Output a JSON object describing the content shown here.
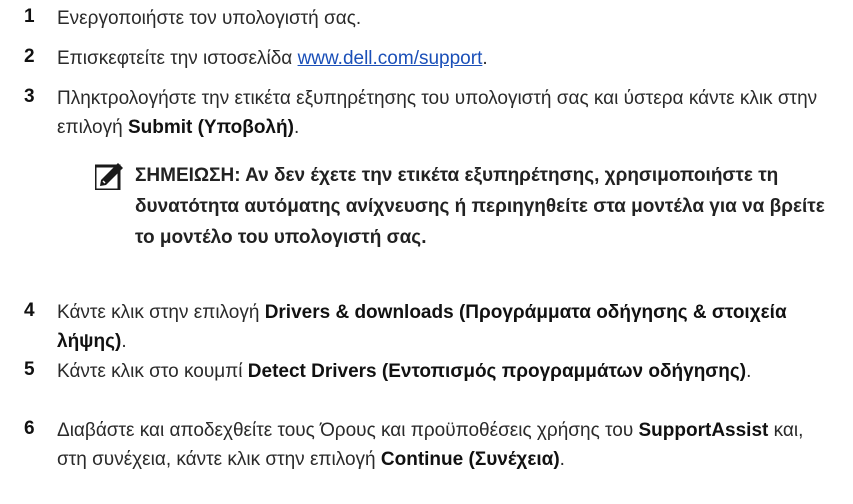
{
  "steps": [
    {
      "num": "1",
      "text": "Ενεργοποιήστε τον υπολογιστή σας."
    },
    {
      "num": "2",
      "text_before": "Επισκεφτείτε την ιστοσελίδα ",
      "link": "www.dell.com/support",
      "text_after": "."
    },
    {
      "num": "3",
      "text": "Πληκτρολογήστε την ετικέτα εξυπηρέτησης του υπολογιστή σας και ύστερα κάντε κλικ στην επιλογή ",
      "bold": "Submit (Υποβολή)",
      "text_after": "."
    },
    {
      "num": "4",
      "text": "Κάντε κλικ στην επιλογή ",
      "bold": "Drivers & downloads (Προγράμματα οδήγησης & στοιχεία λήψης)",
      "text_after": "."
    },
    {
      "num": "5",
      "text": "Κάντε κλικ στο κουμπί ",
      "bold": "Detect Drivers (Εντοπισμός προγραμμάτων οδήγησης)",
      "text_after": "."
    },
    {
      "num": "6",
      "text": "Διαβάστε και αποδεχθείτε τους Όρους και προϋποθέσεις χρήσης του ",
      "bold1": "SupportAssist",
      "text_mid": " και, στη συνέχεια, κάντε κλικ στην επιλογή ",
      "bold2": "Continue (Συνέχεια)",
      "text_after": "."
    }
  ],
  "note": {
    "icon": "pencil-note-icon",
    "text": "ΣΗΜΕΙΩΣΗ: Αν δεν έχετε την ετικέτα εξυπηρέτησης, χρησιμοποιήστε τη δυνατότητα αυτόματης ανίχνευσης ή περιηγηθείτε στα μοντέλα για να βρείτε το μοντέλο του υπολογιστή σας."
  }
}
